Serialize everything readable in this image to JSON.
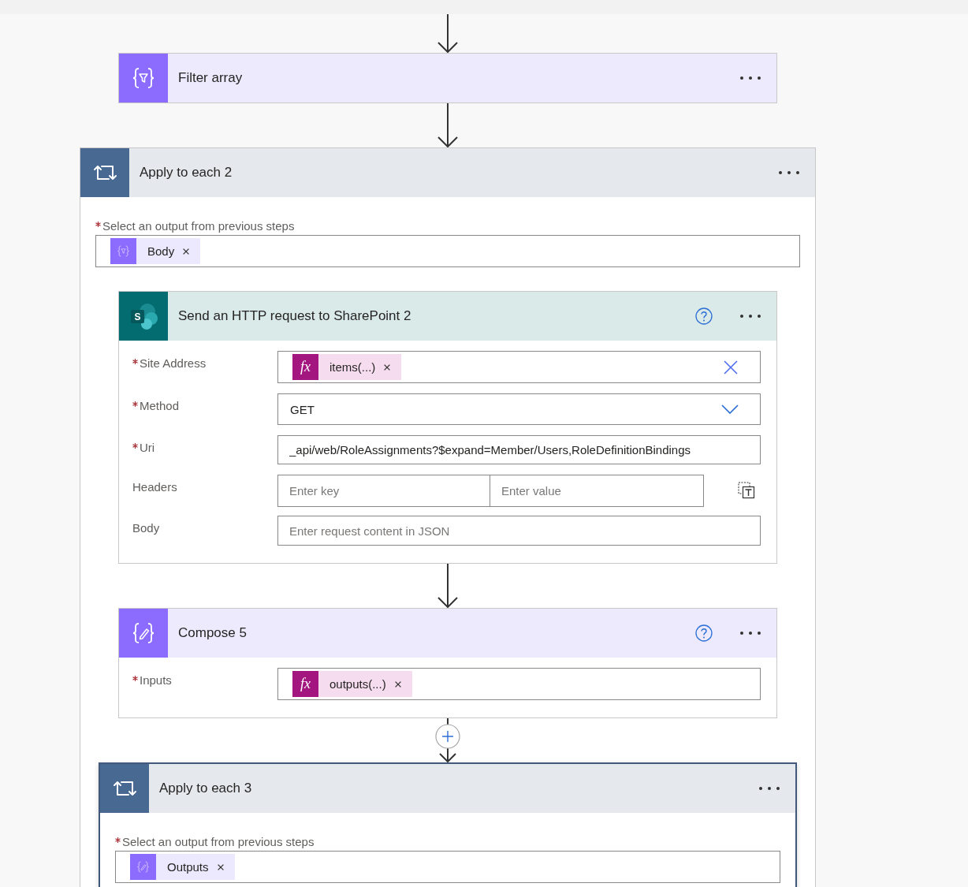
{
  "steps": [
    {
      "kind": "filter",
      "title": "Filter array",
      "help": false,
      "selected": false,
      "add_button": false
    },
    {
      "kind": "foreach",
      "title": "Apply to each 2",
      "help": false,
      "selected": false,
      "add_button": false,
      "fields": [
        {
          "kind": "tokens",
          "label": "Select an output from previous steps",
          "required": true,
          "tokens": [
            {
              "kind": "filter",
              "label": "Body"
            }
          ]
        }
      ],
      "children": [
        {
          "kind": "sharepoint",
          "title": "Send an HTTP request to SharePoint 2",
          "logo_text": "S",
          "help": true,
          "selected": false,
          "add_button": false,
          "fields": [
            {
              "kind": "combo",
              "label": "Site Address",
              "required": true,
              "tokens": [
                {
                  "kind": "expression",
                  "symbol": "fx",
                  "label": "items(...)"
                }
              ]
            },
            {
              "kind": "select",
              "label": "Method",
              "required": true,
              "value": "GET"
            },
            {
              "kind": "text",
              "label": "Uri",
              "required": true,
              "value": "_api/web/RoleAssignments?$expand=Member/Users,RoleDefinitionBindings"
            },
            {
              "kind": "keyvalue",
              "label": "Headers",
              "required": false,
              "inputs": [
                {
                  "placeholder": "Enter key"
                },
                {
                  "placeholder": "Enter value"
                }
              ]
            },
            {
              "kind": "text",
              "label": "Body",
              "required": false,
              "placeholder": "Enter request content in JSON"
            }
          ]
        },
        {
          "kind": "compose",
          "title": "Compose 5",
          "help": true,
          "selected": false,
          "add_button": false,
          "fields": [
            {
              "kind": "tokens",
              "label": "Inputs",
              "required": true,
              "tokens": [
                {
                  "kind": "expression",
                  "symbol": "fx",
                  "label": "outputs(...)"
                }
              ]
            }
          ]
        },
        {
          "kind": "foreach",
          "title": "Apply to each 3",
          "help": false,
          "selected": true,
          "add_button": true,
          "fields": [
            {
              "kind": "tokens",
              "label": "Select an output from previous steps",
              "required": true,
              "tokens": [
                {
                  "kind": "compose",
                  "label": "Outputs"
                }
              ]
            }
          ]
        }
      ]
    }
  ]
}
